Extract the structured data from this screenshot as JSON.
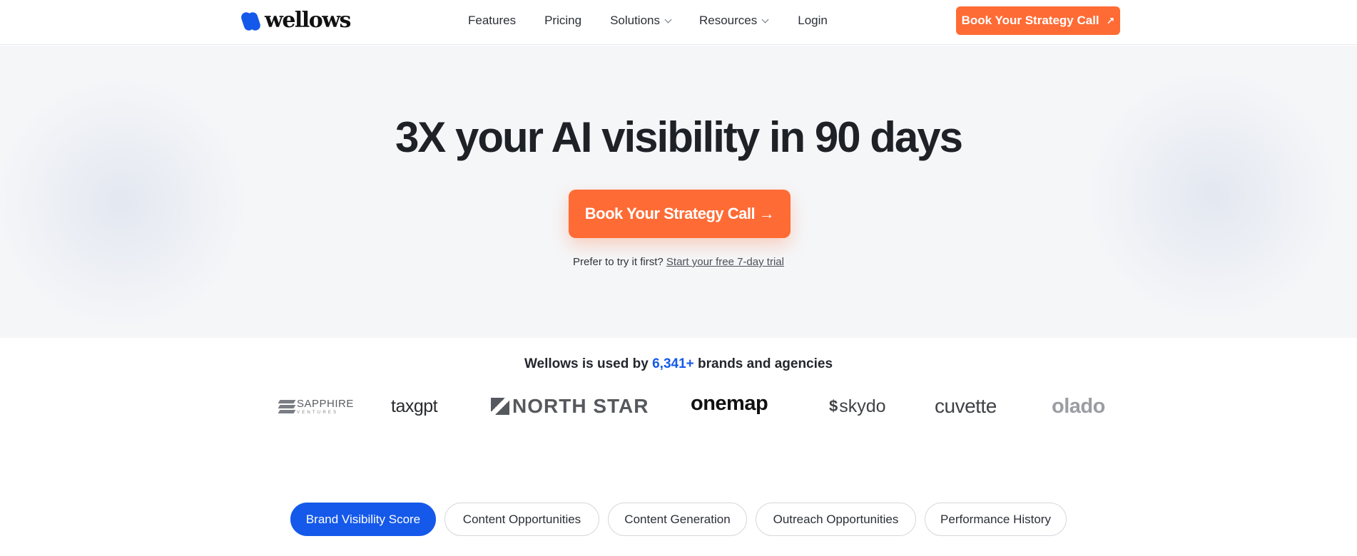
{
  "brand": {
    "logo_text": "wellows"
  },
  "nav": {
    "links": [
      {
        "label": "Features",
        "has_dropdown": false
      },
      {
        "label": "Pricing",
        "has_dropdown": false
      },
      {
        "label": "Solutions",
        "has_dropdown": true
      },
      {
        "label": "Resources",
        "has_dropdown": true
      },
      {
        "label": "Login",
        "has_dropdown": false
      }
    ],
    "cta_label": "Book Your Strategy Call",
    "cta_icon": "arrow-up-right-icon"
  },
  "hero": {
    "title": "3X your AI visibility in 90 days",
    "cta_label": "Book Your Strategy Call →",
    "sub_text": "Prefer to try it first?",
    "trial_link": "Start your free 7-day trial"
  },
  "trust": {
    "prefix": "Wellows is used by",
    "count": "6,341+",
    "suffix": "brands and agencies"
  },
  "logos": {
    "sapphire_line1": "SAPPHIRE",
    "sapphire_line2": "VENTURES",
    "taxgpt": "taxgpt",
    "northstar": "NORTH STAR",
    "onemap": "onemap",
    "skydo": "skydo",
    "cuvette": "cuvette",
    "olado": "olado"
  },
  "tabs": [
    {
      "label": "Brand Visibility Score",
      "active": true
    },
    {
      "label": "Content Opportunities",
      "active": false
    },
    {
      "label": "Content Generation",
      "active": false
    },
    {
      "label": "Outreach Opportunities",
      "active": false
    },
    {
      "label": "Performance History",
      "active": false
    }
  ],
  "colors": {
    "accent_orange": "#ff6b35",
    "brand_blue": "#1559ea",
    "hero_bg": "#f5f6f8"
  }
}
